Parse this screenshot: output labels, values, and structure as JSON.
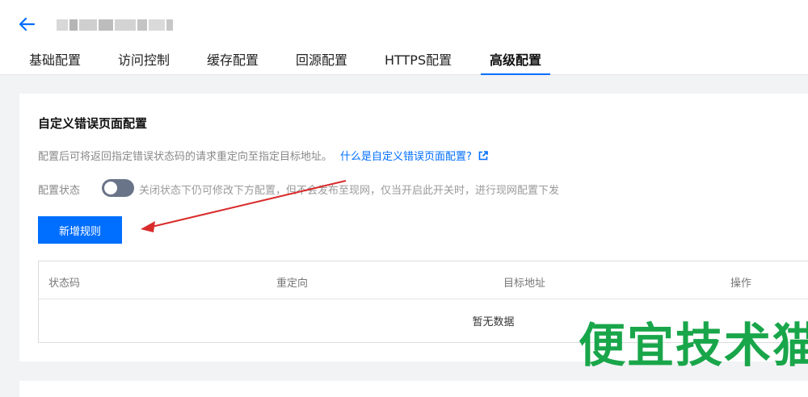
{
  "header": {
    "tabs": [
      {
        "label": "基础配置"
      },
      {
        "label": "访问控制"
      },
      {
        "label": "缓存配置"
      },
      {
        "label": "回源配置"
      },
      {
        "label": "HTTPS配置"
      },
      {
        "label": "高级配置",
        "active": true
      }
    ]
  },
  "section": {
    "title": "自定义错误页面配置",
    "description": "配置后可将返回指定错误状态码的请求重定向至指定目标地址。",
    "help_link": "什么是自定义错误页面配置?",
    "status_label": "配置状态",
    "switch_on": false,
    "switch_hint": "关闭状态下仍可修改下方配置，但不会发布至现网，仅当开启此开关时，进行现网配置下发",
    "add_button": "新增规则"
  },
  "table": {
    "columns": [
      "状态码",
      "重定向",
      "目标地址",
      "操作"
    ],
    "empty_text": "暂无数据"
  },
  "watermark": "便宜技术猫",
  "colors": {
    "primary": "#006eff",
    "switch_off": "#6a7489",
    "watermark": "#19a64a",
    "arrow": "#d92b2b"
  }
}
